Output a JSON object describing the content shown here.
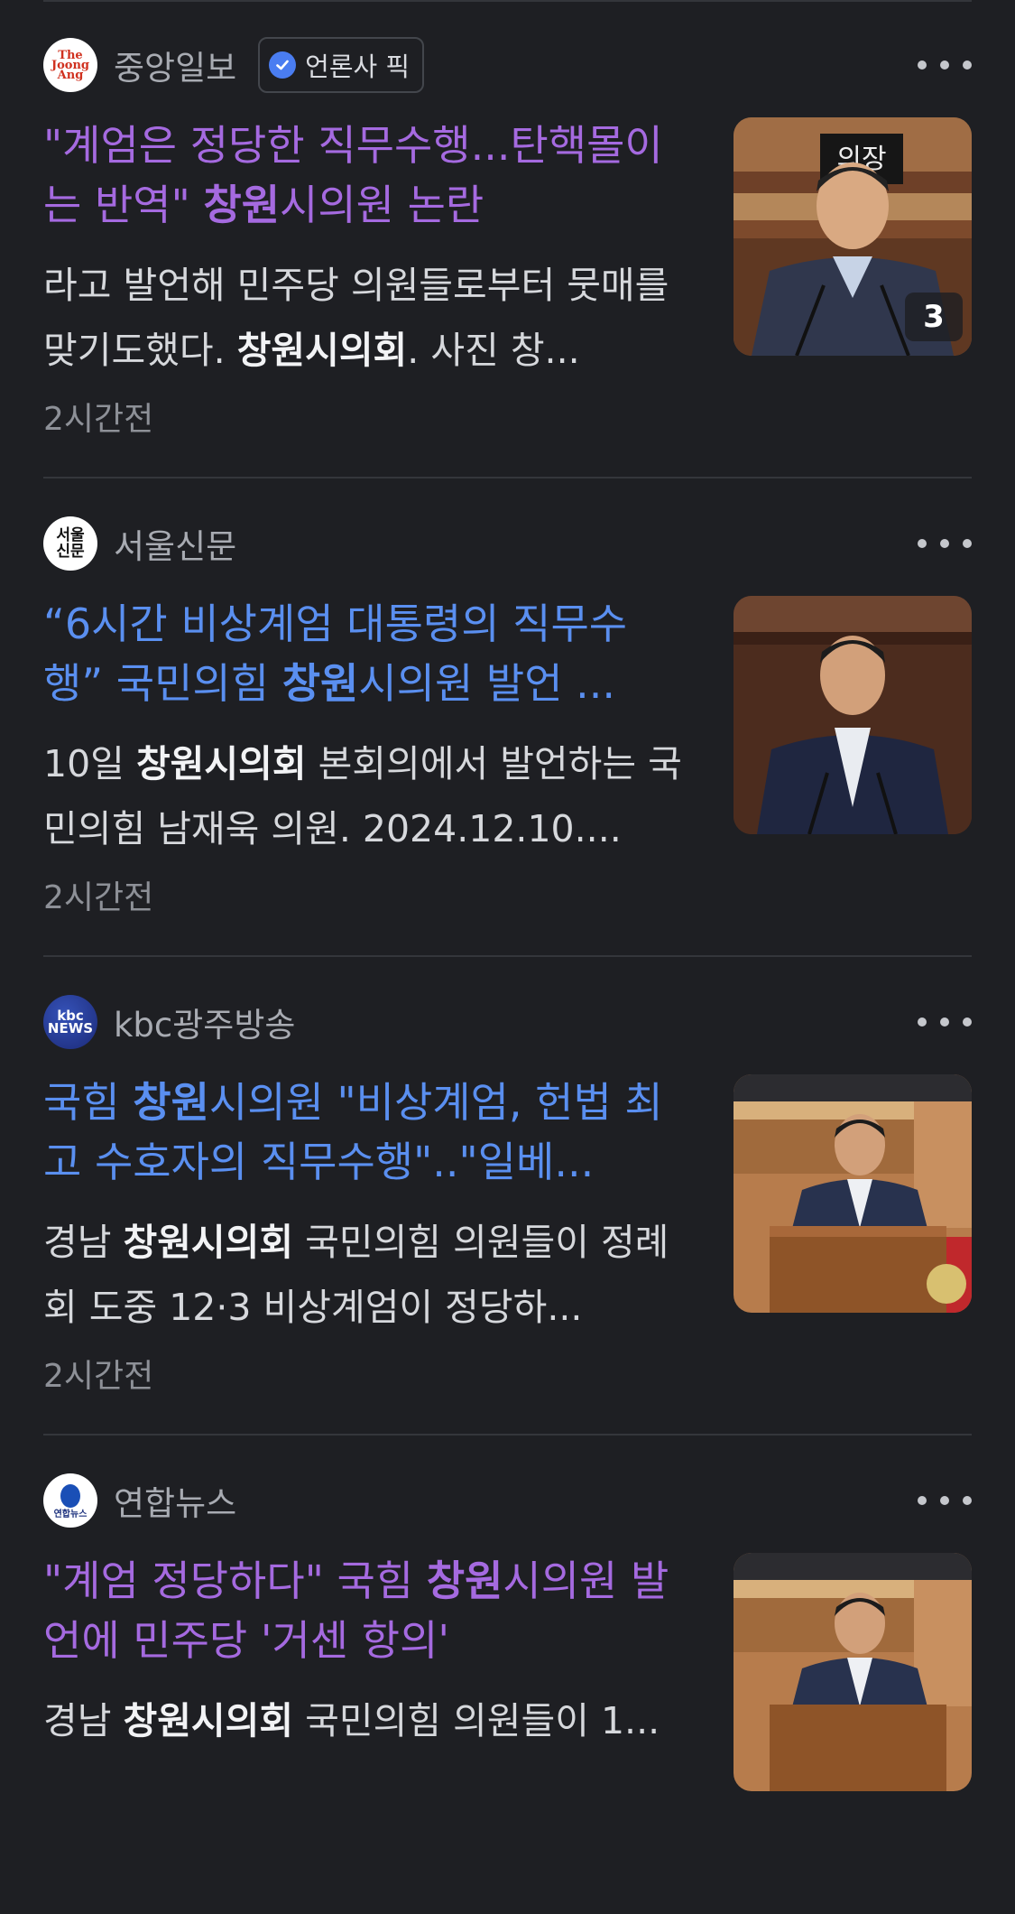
{
  "articles": [
    {
      "source": "중앙일보",
      "logo_text": "The Joong Ang",
      "badge": "언론사 픽",
      "headline_pre": "\"계엄은 정당한 직무수행...탄핵몰이는 반역\" ",
      "headline_bold": "창원",
      "headline_post": "시의원 논란",
      "headline_state": "visited",
      "snippet_pre": "라고 발언해 민주당 의원들로부터 뭇매를 맞기도했다. ",
      "snippet_bold": "창원시의회",
      "snippet_post": ". 사진 창...",
      "time": "2시간전",
      "image_count": "3"
    },
    {
      "source": "서울신문",
      "logo_text": "서울 신문",
      "badge": "",
      "headline_pre": "“6시간 비상계엄 대통령의 직무수행” 국민의힘 ",
      "headline_bold": "창원",
      "headline_post": "시의원 발언 ...",
      "headline_state": "unvisited",
      "snippet_pre": "10일 ",
      "snippet_bold": "창원시의회",
      "snippet_post": " 본회의에서 발언하는 국민의힘 남재욱 의원. 2024.12.10....",
      "time": "2시간전",
      "image_count": ""
    },
    {
      "source": "kbc광주방송",
      "logo_text": "kbc NEWS",
      "badge": "",
      "headline_pre": "국힘 ",
      "headline_bold": "창원",
      "headline_post": "시의원 \"비상계엄, 헌법 최고 수호자의 직무수행\"..\"일베...",
      "headline_state": "unvisited",
      "snippet_pre": "경남 ",
      "snippet_bold": "창원시의회",
      "snippet_post": " 국민의힘 의원들이 정례회 도중 12·3 비상계엄이 정당하...",
      "time": "2시간전",
      "image_count": ""
    },
    {
      "source": "연합뉴스",
      "logo_text": "연합뉴스",
      "badge": "",
      "headline_pre": "\"계엄 정당하다\" 국힘 ",
      "headline_bold": "창원",
      "headline_post": "시의원 발언에 민주당 '거센 항의'",
      "headline_state": "visited",
      "snippet_pre": "경남 ",
      "snippet_bold": "창원시의회",
      "snippet_post": " 국민의힘 의원들이 1...",
      "time": "",
      "image_count": ""
    }
  ],
  "image_signs": {
    "name_plate": "의장"
  },
  "colors": {
    "background": "#1e1f23",
    "visited_link": "#a56ae0",
    "unvisited_link": "#5a8ff0",
    "verified_badge": "#4a7df1"
  }
}
